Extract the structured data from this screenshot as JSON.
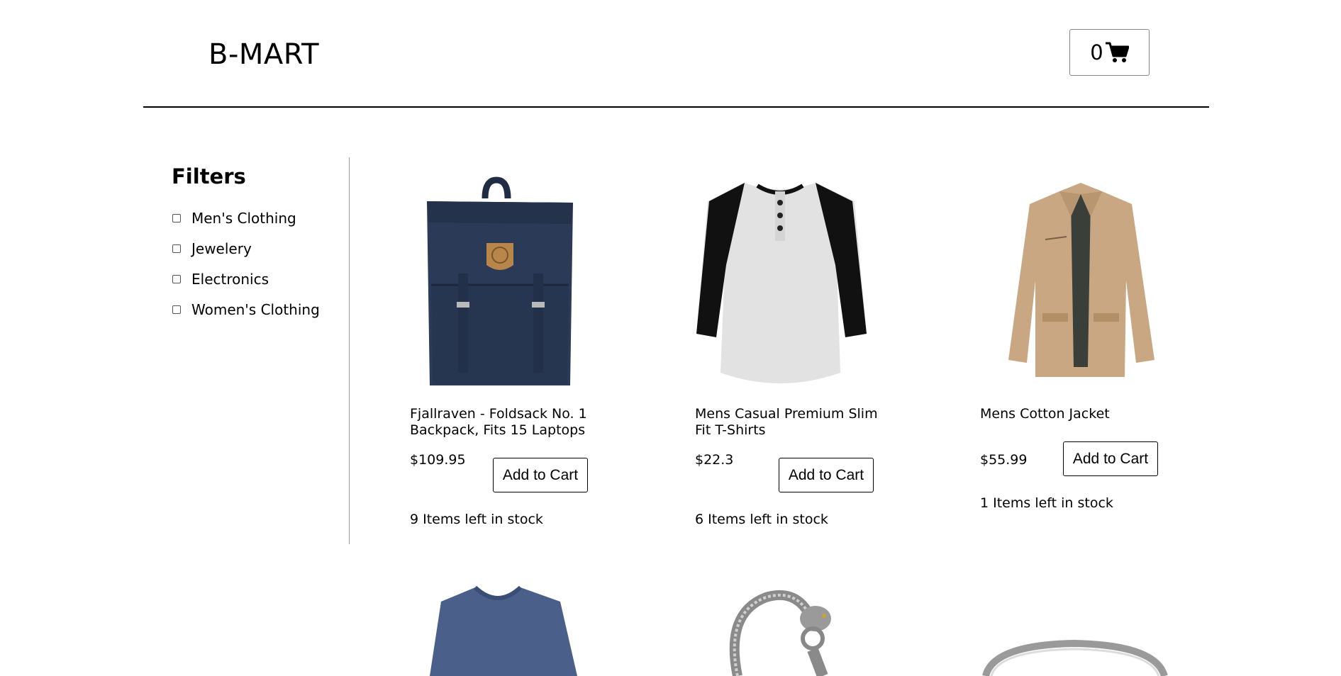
{
  "header": {
    "logo": "B-MART",
    "cart_count": "0",
    "cart_icon": "shopping-cart-icon"
  },
  "sidebar": {
    "title": "Filters",
    "filters": [
      {
        "label": "Men's Clothing",
        "checked": false
      },
      {
        "label": "Jewelery",
        "checked": false
      },
      {
        "label": "Electronics",
        "checked": false
      },
      {
        "label": "Women's Clothing",
        "checked": false
      }
    ]
  },
  "products": [
    {
      "title": "Fjallraven - Foldsack No. 1 Backpack, Fits 15 Laptops",
      "price": "$109.95",
      "button": "Add to Cart",
      "stock": "9 Items left in stock"
    },
    {
      "title": "Mens Casual Premium Slim Fit T-Shirts",
      "price": "$22.3",
      "button": "Add to Cart",
      "stock": "6 Items left in stock"
    },
    {
      "title": "Mens Cotton Jacket",
      "price": "$55.99",
      "button": "Add to Cart",
      "stock": "1 Items left in stock"
    }
  ],
  "colors": {
    "backpack": "#2b3a57",
    "backpack_patch": "#b8864b",
    "tshirt_body": "#e2e2e2",
    "tshirt_sleeve": "#111111",
    "jacket": "#c9a782",
    "sweater": "#4a5f8a",
    "silver": "#9a9a9a"
  }
}
